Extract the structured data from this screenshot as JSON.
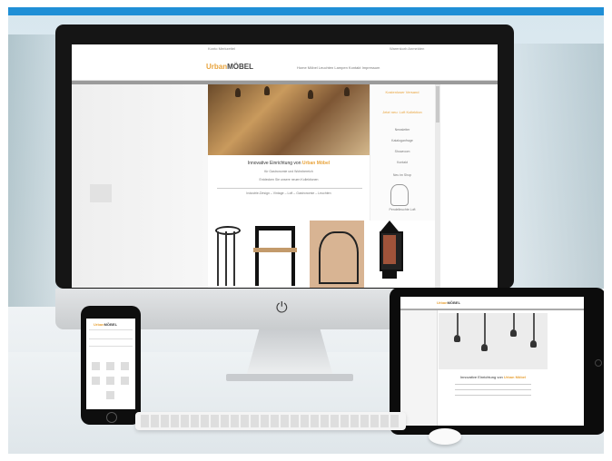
{
  "desktop": {
    "topbar_left": "Konto  Merkzettel",
    "topbar_right": "Warenkorb  Anmelden",
    "logo_prefix": "Urban",
    "logo_main": "MÖBEL",
    "nav": "Home  Möbel  Leuchten  Lampen  Kontakt  Impressum",
    "headline_prefix": "Innovative Einrichtung von",
    "headline_brand": "Urban Möbel",
    "subline1": "für Gastronomie und Wohnbereich",
    "subline2": "Entdecken Sie unsere neuen Kollektionen",
    "subline3": "Industrie-Design – Vintage – Loft – Gastronomie – Leuchten",
    "side_offer1": "Kostenloser Versand",
    "side_offer2": "Jetzt neu: Loft Kollektion",
    "side_links": [
      "Newsletter",
      "Kataloganfrage",
      "Showroom",
      "Kontakt"
    ],
    "side_heading": "Neu im Shop",
    "side_caption": "Pendelleuchte Loft"
  },
  "phone": {
    "logo_prefix": "Urban",
    "logo_main": "MÖBEL"
  },
  "tablet": {
    "logo_prefix": "Urban",
    "logo_main": "MÖBEL",
    "headline": "Innovative Einrichtung von",
    "brand": "Urban Möbel"
  },
  "colors": {
    "accent": "#e8a33b",
    "banner": "#1f8fd6"
  },
  "icons": [
    "power-icon"
  ]
}
